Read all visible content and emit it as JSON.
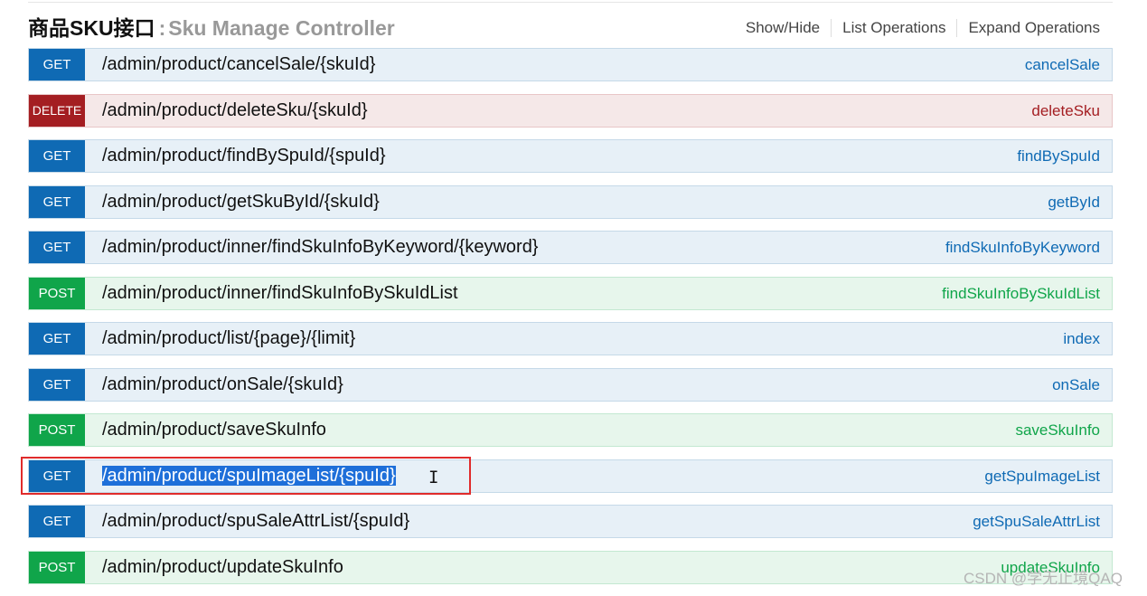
{
  "section": {
    "title_cn": "商品SKU接口",
    "separator": ":",
    "title_en": "Sku Manage Controller"
  },
  "operations": [
    "Show/Hide",
    "List Operations",
    "Expand Operations"
  ],
  "endpoints": [
    {
      "method": "GET",
      "path": "/admin/product/cancelSale/{skuId}",
      "nickname": "cancelSale"
    },
    {
      "method": "DELETE",
      "path": "/admin/product/deleteSku/{skuId}",
      "nickname": "deleteSku"
    },
    {
      "method": "GET",
      "path": "/admin/product/findBySpuId/{spuId}",
      "nickname": "findBySpuId"
    },
    {
      "method": "GET",
      "path": "/admin/product/getSkuById/{skuId}",
      "nickname": "getById"
    },
    {
      "method": "GET",
      "path": "/admin/product/inner/findSkuInfoByKeyword/{keyword}",
      "nickname": "findSkuInfoByKeyword"
    },
    {
      "method": "POST",
      "path": "/admin/product/inner/findSkuInfoBySkuIdList",
      "nickname": "findSkuInfoBySkuIdList"
    },
    {
      "method": "GET",
      "path": "/admin/product/list/{page}/{limit}",
      "nickname": "index"
    },
    {
      "method": "GET",
      "path": "/admin/product/onSale/{skuId}",
      "nickname": "onSale"
    },
    {
      "method": "POST",
      "path": "/admin/product/saveSkuInfo",
      "nickname": "saveSkuInfo"
    },
    {
      "method": "GET",
      "path": "/admin/product/spuImageList/{spuId}",
      "nickname": "getSpuImageList",
      "selected": true
    },
    {
      "method": "GET",
      "path": "/admin/product/spuSaleAttrList/{spuId}",
      "nickname": "getSpuSaleAttrList"
    },
    {
      "method": "POST",
      "path": "/admin/product/updateSkuInfo",
      "nickname": "updateSkuInfo"
    }
  ],
  "watermark": "CSDN @学无止境QAQ",
  "colors": {
    "get": "#0f6ab4",
    "delete": "#a41e22",
    "post": "#10a54a",
    "highlight": "#e02b2b",
    "selection": "#1e6fd9"
  }
}
